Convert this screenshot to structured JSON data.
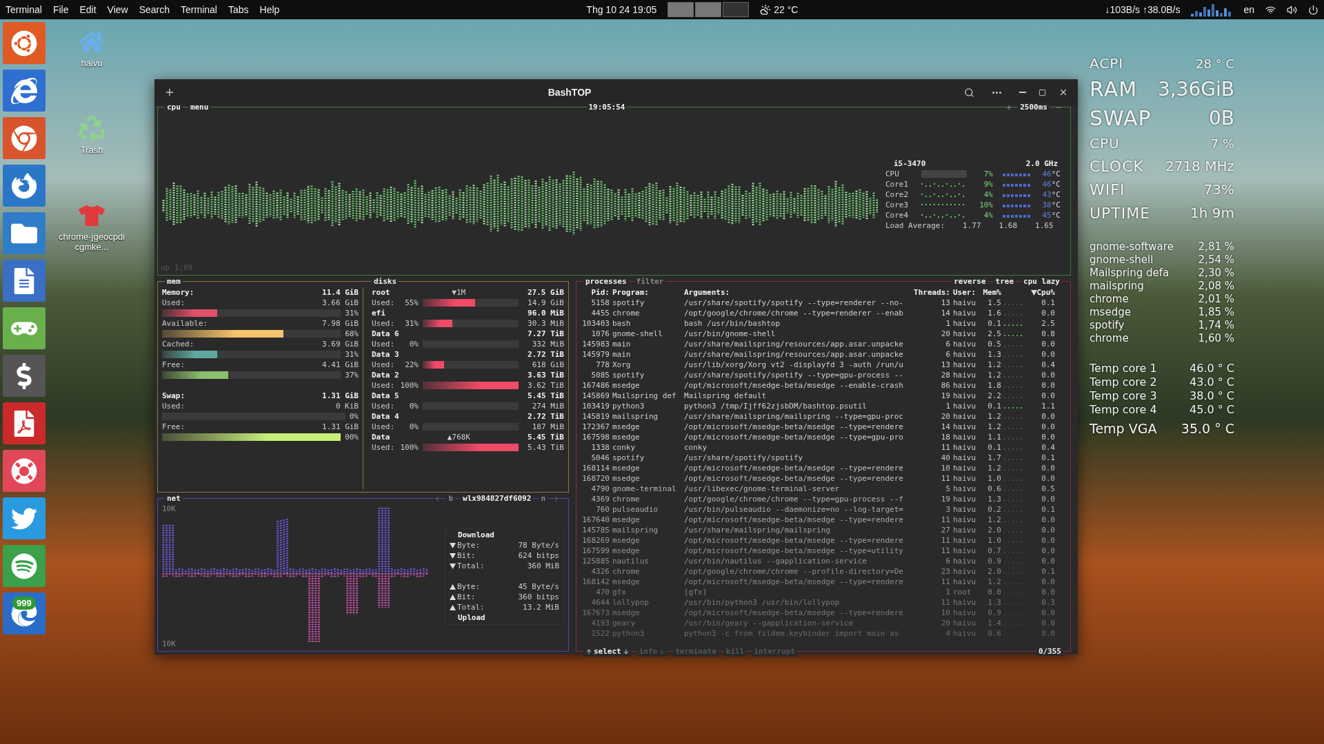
{
  "topbar": {
    "app": "Terminal",
    "menus": [
      "File",
      "Edit",
      "View",
      "Search",
      "Terminal",
      "Tabs",
      "Help"
    ],
    "clock": "Thg 10 24 19:05",
    "weather": "22 °C",
    "net_speed": "↓103B/s ↑38.0B/s",
    "lang": "en"
  },
  "dock": {
    "badge": "999"
  },
  "desktop_icons": [
    {
      "label": "haivu",
      "kind": "home"
    },
    {
      "label": "Trash",
      "kind": "trash"
    },
    {
      "label": "chrome-jgeocpdicgmke...",
      "kind": "app"
    }
  ],
  "window": {
    "title": "BashTOP"
  },
  "cpu": {
    "tabs": [
      "cpu",
      "menu"
    ],
    "time": "19:05:54",
    "interval": "2500ms",
    "uptime": "up 1:09",
    "model": "i5-3470",
    "freq": "2.0 GHz",
    "rows": [
      {
        "kind": "total",
        "name": "CPU",
        "percent": "7%",
        "temp": "46",
        "unit": "°C"
      },
      {
        "kind": "core",
        "name": "Core1",
        "percent": "9%",
        "temp": "46",
        "unit": "°C"
      },
      {
        "kind": "core",
        "name": "Core2",
        "percent": "4%",
        "temp": "43",
        "unit": "°C"
      },
      {
        "kind": "core",
        "name": "Core3",
        "percent": "10%",
        "temp": "38",
        "unit": "°C"
      },
      {
        "kind": "core",
        "name": "Core4",
        "percent": "4%",
        "temp": "45",
        "unit": "°C"
      }
    ],
    "load_label": "Load Average:",
    "load": [
      "1.77",
      "1.68",
      "1.65"
    ]
  },
  "mem": {
    "title": "mem",
    "items": [
      {
        "kind": "header",
        "label": "Memory:",
        "value": "11.4 GiB"
      },
      {
        "kind": "meter",
        "label": "Used:",
        "value": "3.66 GiB",
        "percent": "31%",
        "level": 0.31,
        "color": "#e0506a"
      },
      {
        "kind": "meter",
        "label": "Available:",
        "value": "7.98 GiB",
        "percent": "68%",
        "level": 0.68,
        "color": "#f6c46a"
      },
      {
        "kind": "meter",
        "label": "Cached:",
        "value": "3.69 GiB",
        "percent": "31%",
        "level": 0.31,
        "color": "#5fa8a0"
      },
      {
        "kind": "meter",
        "label": "Free:",
        "value": "4.41 GiB",
        "percent": "37%",
        "level": 0.37,
        "color": "#8cc070"
      },
      {
        "kind": "gap"
      },
      {
        "kind": "header",
        "label": "Swap:",
        "value": "1.31 GiB"
      },
      {
        "kind": "meter",
        "label": "Used:",
        "value": "0 KiB",
        "percent": "0%",
        "level": 0
      },
      {
        "kind": "meter",
        "label": "Free:",
        "value": "1.31 GiB",
        "percent": "00%",
        "level": 1,
        "color": "#c8f07a"
      }
    ]
  },
  "disks": {
    "title": "disks",
    "items": [
      {
        "name": "root",
        "io": "▼1M",
        "total": "27.5 GiB",
        "used_label": "Used:",
        "used_pct": "55%",
        "level": 0.55,
        "used": "14.9 GiB"
      },
      {
        "name": "efi",
        "total": "96.0 MiB",
        "used_label": "Used:",
        "used_pct": "31%",
        "level": 0.31,
        "used": "30.3 MiB"
      },
      {
        "name": "Data 6",
        "total": "7.27 TiB",
        "used_label": "Used:",
        "used_pct": "0%",
        "level": 0,
        "used": "332 MiB"
      },
      {
        "name": "Data 3",
        "total": "2.72 TiB",
        "used_label": "Used:",
        "used_pct": "22%",
        "level": 0.22,
        "used": "618 GiB"
      },
      {
        "name": "Data 2",
        "total": "3.63 TiB",
        "used_label": "Used:",
        "used_pct": "100%",
        "level": 1,
        "used": "3.62 TiB"
      },
      {
        "name": "Data 5",
        "total": "5.45 TiB",
        "used_label": "Used:",
        "used_pct": "0%",
        "level": 0,
        "used": "274 MiB"
      },
      {
        "name": "Data 4",
        "total": "2.72 TiB",
        "used_label": "Used:",
        "used_pct": "0%",
        "level": 0,
        "used": "187 MiB"
      },
      {
        "name": "Data",
        "io": "▲768K",
        "total": "5.45 TiB",
        "used_label": "Used:",
        "used_pct": "100%",
        "level": 1,
        "used": "5.43 TiB"
      }
    ]
  },
  "processes": {
    "tabs": [
      {
        "label": "processes",
        "selected": true
      },
      {
        "label": "filter",
        "selected": false
      }
    ],
    "options": [
      "reverse",
      "tree",
      "cpu lazy"
    ],
    "columns": [
      {
        "label": "Pid:",
        "sorted": false
      },
      {
        "label": "Program:",
        "sorted": false
      },
      {
        "label": "Arguments:",
        "sorted": false
      },
      {
        "label": "Threads:",
        "sorted": false
      },
      {
        "label": "User:",
        "sorted": false
      },
      {
        "label": "Mem%",
        "sorted": false
      },
      {
        "label": "Cpu%",
        "sorted": true
      }
    ],
    "rows": [
      [
        "5158",
        "spotify",
        "/usr/share/spotify/spotify --type=renderer --no-",
        "13",
        "haivu",
        "1.5",
        "0.1"
      ],
      [
        "4455",
        "chrome",
        "/opt/google/chrome/chrome --type=renderer --enab",
        "14",
        "haivu",
        "1.6",
        "0.0"
      ],
      [
        "103403",
        "bash",
        "bash /usr/bin/bashtop",
        "1",
        "haivu",
        "0.1",
        "2.5"
      ],
      [
        "1076",
        "gnome-shell",
        "/usr/bin/gnome-shell",
        "20",
        "haivu",
        "2.5",
        "0.8"
      ],
      [
        "145983",
        "main",
        "/usr/share/mailspring/resources/app.asar.unpacke",
        "6",
        "haivu",
        "0.5",
        "0.0"
      ],
      [
        "145979",
        "main",
        "/usr/share/mailspring/resources/app.asar.unpacke",
        "6",
        "haivu",
        "1.3",
        "0.0"
      ],
      [
        "778",
        "Xorg",
        "/usr/lib/xorg/Xorg vt2 -displayfd 3 -auth /run/u",
        "13",
        "haivu",
        "1.2",
        "0.4"
      ],
      [
        "5085",
        "spotify",
        "/usr/share/spotify/spotify --type=gpu-process --",
        "28",
        "haivu",
        "1.2",
        "0.0"
      ],
      [
        "167486",
        "msedge",
        "/opt/microsoft/msedge-beta/msedge --enable-crash",
        "86",
        "haivu",
        "1.8",
        "0.0"
      ],
      [
        "145869",
        "Mailspring def",
        "Mailspring default",
        "19",
        "haivu",
        "2.2",
        "0.0"
      ],
      [
        "103419",
        "python3",
        "python3 /tmp/Ijff62zjsbDM/bashtop.psutil",
        "1",
        "haivu",
        "0.1",
        "1.1"
      ],
      [
        "145819",
        "mailspring",
        "/usr/share/mailspring/mailspring --type=gpu-proc",
        "20",
        "haivu",
        "1.2",
        "0.0"
      ],
      [
        "172367",
        "msedge",
        "/opt/microsoft/msedge-beta/msedge --type=rendere",
        "14",
        "haivu",
        "1.2",
        "0.0"
      ],
      [
        "167598",
        "msedge",
        "/opt/microsoft/msedge-beta/msedge --type=gpu-pro",
        "18",
        "haivu",
        "1.1",
        "0.0"
      ],
      [
        "1338",
        "conky",
        "conky",
        "11",
        "haivu",
        "0.1",
        "0.4"
      ],
      [
        "5046",
        "spotify",
        "/usr/share/spotify/spotify",
        "40",
        "haivu",
        "1.7",
        "0.1"
      ],
      [
        "168114",
        "msedge",
        "/opt/microsoft/msedge-beta/msedge --type=rendere",
        "10",
        "haivu",
        "1.2",
        "0.0"
      ],
      [
        "168720",
        "msedge",
        "/opt/microsoft/msedge-beta/msedge --type=rendere",
        "11",
        "haivu",
        "1.0",
        "0.0"
      ],
      [
        "4790",
        "gnome-terminal",
        "/usr/libexec/gnome-terminal-server",
        "5",
        "haivu",
        "0.6",
        "0.5"
      ],
      [
        "4369",
        "chrome",
        "/opt/google/chrome/chrome --type=gpu-process --f",
        "19",
        "haivu",
        "1.3",
        "0.0"
      ],
      [
        "760",
        "pulseaudio",
        "/usr/bin/pulseaudio --daemonize=no --log-target=",
        "3",
        "haivu",
        "0.2",
        "0.1"
      ],
      [
        "167640",
        "msedge",
        "/opt/microsoft/msedge-beta/msedge --type=rendere",
        "11",
        "haivu",
        "1.2",
        "0.0"
      ],
      [
        "145785",
        "mailspring",
        "/usr/share/mailspring/mailspring",
        "27",
        "haivu",
        "2.0",
        "0.0"
      ],
      [
        "168269",
        "msedge",
        "/opt/microsoft/msedge-beta/msedge --type=rendere",
        "11",
        "haivu",
        "1.0",
        "0.0"
      ],
      [
        "167599",
        "msedge",
        "/opt/microsoft/msedge-beta/msedge --type=utility",
        "11",
        "haivu",
        "0.7",
        "0.0"
      ],
      [
        "125885",
        "nautilus",
        "/usr/bin/nautilus --gapplication-service",
        "6",
        "haivu",
        "0.9",
        "0.0"
      ],
      [
        "4326",
        "chrome",
        "/opt/google/chrome/chrome --profile-directory=De",
        "23",
        "haivu",
        "2.0",
        "0.1"
      ],
      [
        "168142",
        "msedge",
        "/opt/microsoft/msedge-beta/msedge --type=rendere",
        "11",
        "haivu",
        "1.2",
        "0.0"
      ],
      [
        "470",
        "gfx",
        "[gfx]",
        "1",
        "root",
        "0.0",
        "0.0"
      ],
      [
        "4644",
        "lollypop",
        "/usr/bin/python3 /usr/bin/lollypop",
        "11",
        "haivu",
        "1.3",
        "0.3"
      ],
      [
        "167673",
        "msedge",
        "/opt/microsoft/msedge-beta/msedge --type=rendere",
        "10",
        "haivu",
        "0.9",
        "0.0"
      ],
      [
        "4193",
        "geary",
        "/usr/bin/geary --gapplication-service",
        "20",
        "haivu",
        "1.4",
        "0.0"
      ],
      [
        "1522",
        "python3",
        "python3 -c from fildem.keybinder import main as",
        "4",
        "haivu",
        "0.6",
        "0.0"
      ]
    ],
    "footer": [
      {
        "label": "select",
        "disabled": false
      },
      {
        "label": "info",
        "disabled": true
      },
      {
        "label": "terminate",
        "disabled": true
      },
      {
        "label": "kill",
        "disabled": true
      },
      {
        "label": "interrupt",
        "disabled": true
      }
    ],
    "count": "0/355"
  },
  "net": {
    "title": "net",
    "prev_key": "b",
    "iface": "wlx984827df6092",
    "next_key": "n",
    "scale_top": "10K",
    "scale_bottom": "10K",
    "download_title": "Download",
    "upload_title": "Upload",
    "download": [
      {
        "label": "Byte:",
        "value": "78 Byte/s"
      },
      {
        "label": "Bit:",
        "value": "624 bitps"
      },
      {
        "label": "Total:",
        "value": "360 MiB"
      }
    ],
    "upload": [
      {
        "label": "Byte:",
        "value": "45 Byte/s"
      },
      {
        "label": "Bit:",
        "value": "360 bitps"
      },
      {
        "label": "Total:",
        "value": "13.2 MiB"
      }
    ]
  },
  "conky": {
    "stats": [
      {
        "kind": "small",
        "label": "ACPI",
        "value": "28 ° C"
      },
      {
        "kind": "large",
        "label": "RAM",
        "value": "3,36GiB"
      },
      {
        "kind": "large",
        "label": "SWAP",
        "value": "0B"
      },
      {
        "kind": "small",
        "label": "CPU",
        "value": "7 %"
      },
      {
        "kind": "medium",
        "label": "CLOCK",
        "value": "2718 MHz"
      },
      {
        "kind": "medium",
        "label": "WIFI",
        "value": "73%"
      },
      {
        "kind": "medium",
        "label": "UPTIME",
        "value": "1h 9m"
      }
    ],
    "procs": [
      [
        "gnome-software",
        "2,81 %"
      ],
      [
        "gnome-shell",
        "2,54 %"
      ],
      [
        "Mailspring defa",
        "2,30 %"
      ],
      [
        "mailspring",
        "2,08 %"
      ],
      [
        "chrome",
        "2,01 %"
      ],
      [
        "msedge",
        "1,85 %"
      ],
      [
        "spotify",
        "1,74 %"
      ],
      [
        "chrome",
        "1,60 %"
      ]
    ],
    "temps": [
      [
        "Temp core 1",
        "46.0 ° C"
      ],
      [
        "Temp core 2",
        "43.0 ° C"
      ],
      [
        "Temp core 3",
        "38.0 ° C"
      ],
      [
        "Temp core 4",
        "45.0 ° C"
      ]
    ],
    "vga": [
      "Temp VGA",
      "35.0 ° C"
    ]
  }
}
